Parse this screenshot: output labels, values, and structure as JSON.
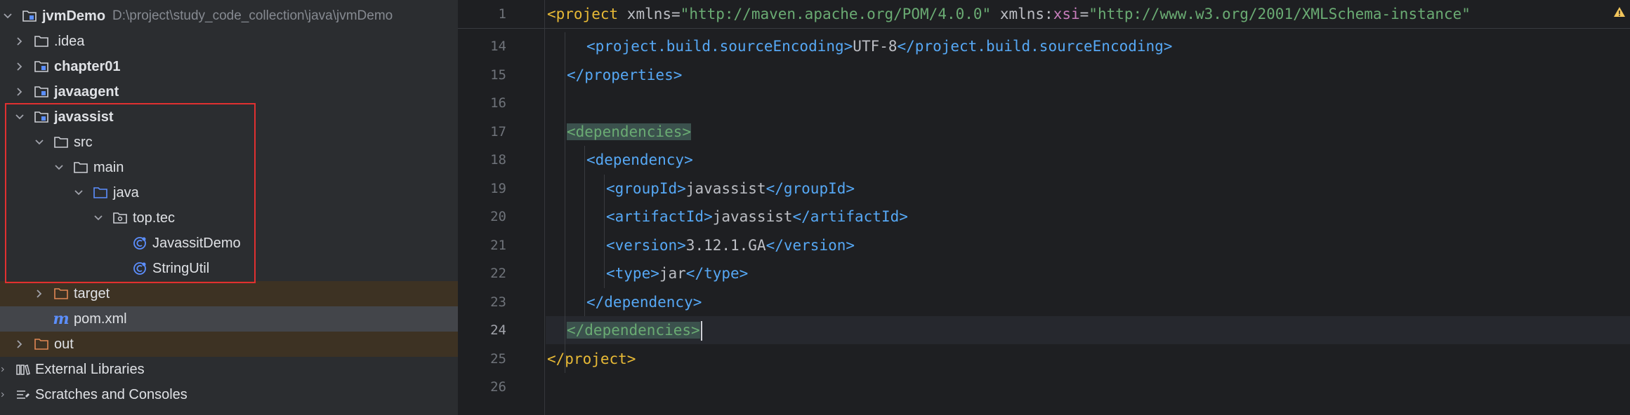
{
  "tree": {
    "root": {
      "name": "jvmDemo",
      "path": "D:\\project\\study_code_collection\\java\\jvmDemo"
    },
    "items": [
      {
        "label": "jvmDemo"
      },
      {
        "label": ".idea"
      },
      {
        "label": "chapter01"
      },
      {
        "label": "javaagent"
      },
      {
        "label": "javassist"
      },
      {
        "label": "src"
      },
      {
        "label": "main"
      },
      {
        "label": "java"
      },
      {
        "label": "top.tec"
      },
      {
        "label": "JavassitDemo"
      },
      {
        "label": "StringUtil"
      },
      {
        "label": "target"
      },
      {
        "label": "pom.xml"
      },
      {
        "label": "out"
      },
      {
        "label": "External Libraries"
      },
      {
        "label": "Scratches and Consoles"
      }
    ],
    "maven_glyph": "m"
  },
  "editor": {
    "line_numbers": [
      "1",
      "14",
      "15",
      "16",
      "17",
      "18",
      "19",
      "20",
      "21",
      "22",
      "23",
      "24",
      "25",
      "26"
    ],
    "sticky": {
      "open": "<project",
      "xmlns_attr": " xmlns=",
      "xmlns_val": "\"http://maven.apache.org/POM/4.0.0\"",
      "xsi_pre": " xmlns:",
      "xsi_ns": "xsi",
      "xsi_eq": "=",
      "xsi_val": "\"http://www.w3.org/2001/XMLSchema-instance\""
    },
    "lines": {
      "l14_open": "<project.build.sourceEncoding>",
      "l14_text": "UTF-8",
      "l14_close": "</project.build.sourceEncoding>",
      "l15": "</properties>",
      "l17": "<dependencies>",
      "l18": "<dependency>",
      "l19_open": "<groupId>",
      "l19_text": "javassist",
      "l19_close": "</groupId>",
      "l20_open": "<artifactId>",
      "l20_text": "javassist",
      "l20_close": "</artifactId>",
      "l21_open": "<version>",
      "l21_text": "3.12.1.GA",
      "l21_close": "</version>",
      "l22_open": "<type>",
      "l22_text": "jar",
      "l22_close": "</type>",
      "l23": "</dependency>",
      "l24": "</dependencies>",
      "l25": "</project>"
    }
  },
  "colors": {
    "tag": "#56a8f5",
    "project_tag": "#e8ba36",
    "dependencies_tag": "#6aab73",
    "highlight_box": "#e03030"
  }
}
